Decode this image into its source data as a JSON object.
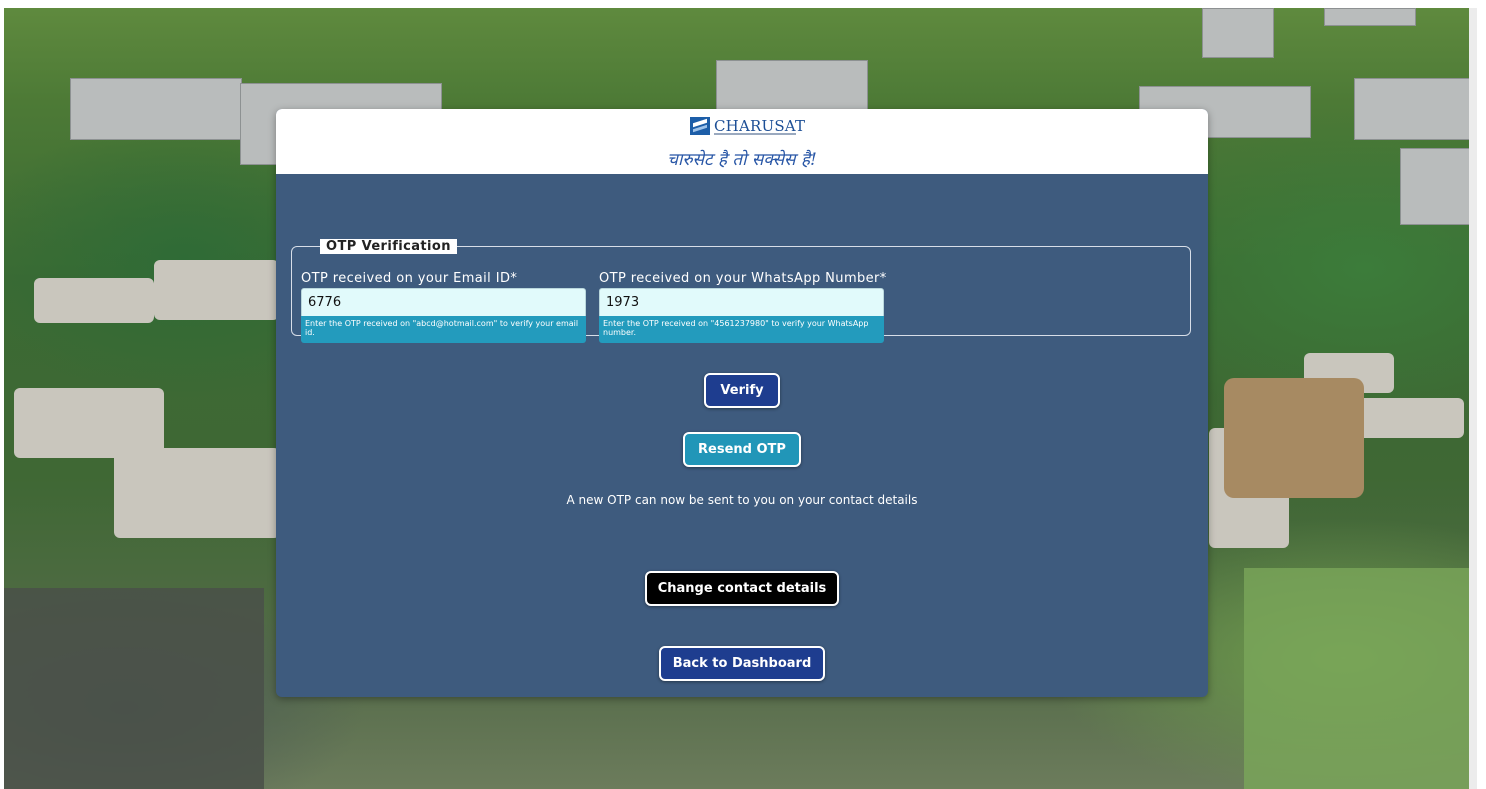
{
  "brand": {
    "logo_text": "CHARUSAT",
    "tagline": "चारुसेट है तो सक्सेस है!"
  },
  "otp_section": {
    "legend": "OTP Verification",
    "email": {
      "label": "OTP received on your Email ID*",
      "value": "6776",
      "help": "Enter the OTP received on \"abcd@hotmail.com\" to verify your email id."
    },
    "whatsapp": {
      "label": "OTP received on your WhatsApp Number*",
      "value": "1973",
      "help": "Enter the OTP received on \"4561237980\" to verify your WhatsApp number."
    }
  },
  "buttons": {
    "verify": "Verify",
    "resend": "Resend OTP",
    "change_contact": "Change contact details",
    "back_dashboard": "Back to Dashboard"
  },
  "notice": "A new OTP can now be sent to you on your contact details",
  "colors": {
    "card_background": "#3e5b7e",
    "primary_button": "#1e3d8f",
    "resend_button": "#2196b8",
    "help_background": "#239bbd",
    "input_background": "#e1fafb"
  }
}
